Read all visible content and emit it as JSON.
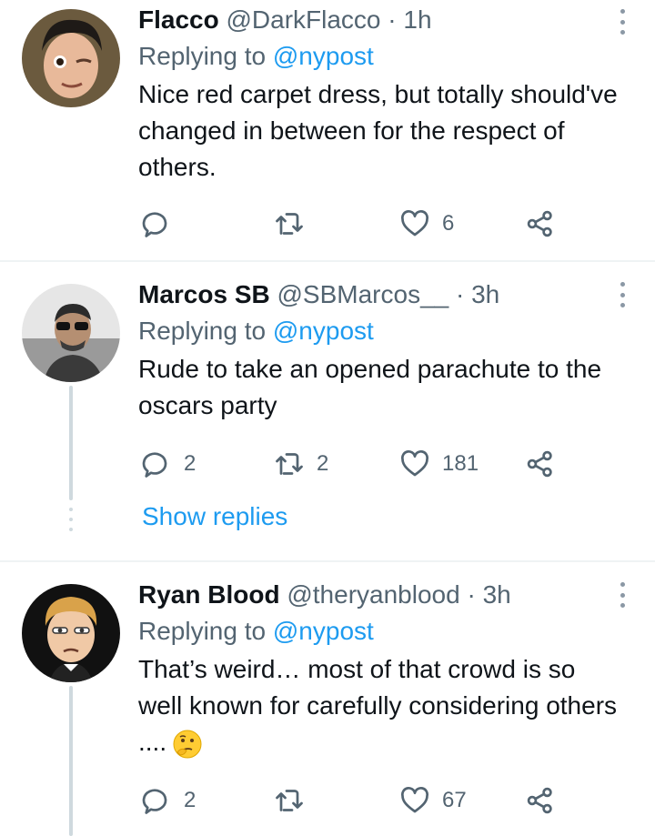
{
  "tweets": [
    {
      "name": "Flacco",
      "handle": "@DarkFlacco",
      "separator": "·",
      "time": "1h",
      "replying_prefix": "Replying to",
      "replying_to": "@nypost",
      "text": "Nice red carpet dress, but totally should've changed in between for the respect of others.",
      "reply_count": "",
      "retweet_count": "",
      "like_count": "6"
    },
    {
      "name": "Marcos SB",
      "handle": "@SBMarcos__",
      "separator": "·",
      "time": "3h",
      "replying_prefix": "Replying to",
      "replying_to": "@nypost",
      "text": "Rude to take an opened parachute to the oscars party",
      "reply_count": "2",
      "retweet_count": "2",
      "like_count": "181",
      "show_replies": "Show replies"
    },
    {
      "name": "Ryan Blood",
      "handle": "@theryanblood",
      "separator": "·",
      "time": "3h",
      "replying_prefix": "Replying to",
      "replying_to": "@nypost",
      "text": "That’s weird… most of that crowd is so well known for carefully considering others ....",
      "reply_count": "2",
      "retweet_count": "",
      "like_count": "67"
    }
  ],
  "icons": {
    "reply": "reply-icon",
    "retweet": "retweet-icon",
    "like": "heart-icon",
    "share": "share-icon",
    "more": "more-icon",
    "emoji": "thinking-face-emoji"
  },
  "colors": {
    "accent": "#1d9bf0",
    "secondary_text": "#536471",
    "divider": "#eff3f4"
  }
}
